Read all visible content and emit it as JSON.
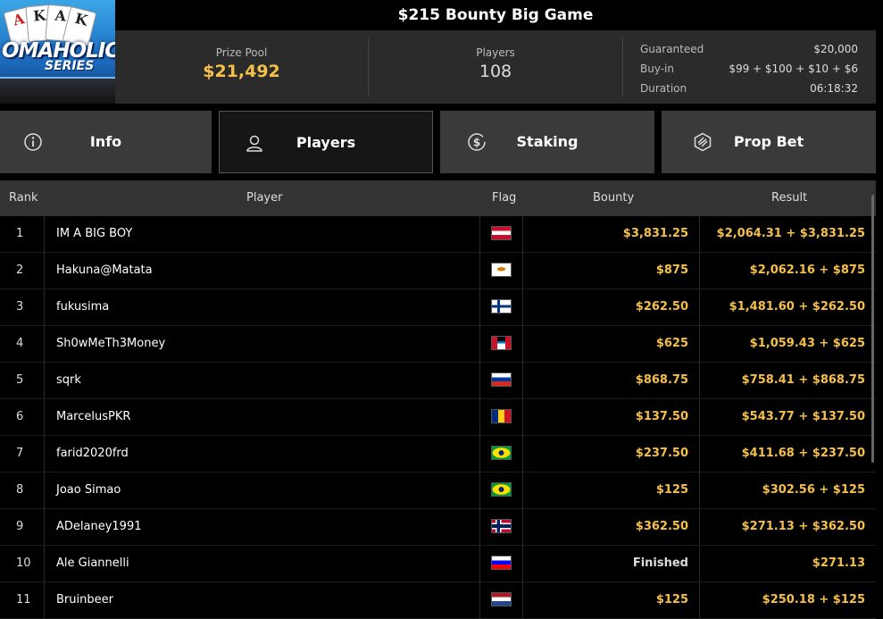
{
  "header": {
    "title": "$215 Bounty Big Game",
    "logo": {
      "title": "OMAHOLIC",
      "series": "SERIES",
      "cards": [
        "A",
        "K",
        "A",
        "K"
      ]
    },
    "prize_pool": {
      "label": "Prize Pool",
      "value": "$21,492"
    },
    "players": {
      "label": "Players",
      "value": "108"
    },
    "details": [
      {
        "label": "Guaranteed",
        "value": "$20,000"
      },
      {
        "label": "Buy-in",
        "value": "$99 + $100 + $10 + $6"
      },
      {
        "label": "Duration",
        "value": "06:18:32"
      }
    ]
  },
  "tabs": [
    {
      "label": "Info",
      "icon": "info-icon",
      "active": false
    },
    {
      "label": "Players",
      "icon": "user-icon",
      "active": true
    },
    {
      "label": "Staking",
      "icon": "dollar-coin-icon",
      "active": false
    },
    {
      "label": "Prop Bet",
      "icon": "prop-bet-icon",
      "active": false
    }
  ],
  "table": {
    "columns": [
      "Rank",
      "Player",
      "Flag",
      "Bounty",
      "Result"
    ],
    "rows": [
      {
        "rank": "1",
        "player": "IM A BIG BOY",
        "flag": "austria",
        "bounty": "$3,831.25",
        "result": "$2,064.31 + $3,831.25"
      },
      {
        "rank": "2",
        "player": "Hakuna@Matata",
        "flag": "cyprus",
        "bounty": "$875",
        "result": "$2,062.16 + $875"
      },
      {
        "rank": "3",
        "player": "fukusima",
        "flag": "finland",
        "bounty": "$262.50",
        "result": "$1,481.60 + $262.50"
      },
      {
        "rank": "4",
        "player": "Sh0wMeTh3Money",
        "flag": "antigua",
        "bounty": "$625",
        "result": "$1,059.43 + $625"
      },
      {
        "rank": "5",
        "player": "sqrk",
        "flag": "russia",
        "bounty": "$868.75",
        "result": "$758.41 + $868.75"
      },
      {
        "rank": "6",
        "player": "MarcelusPKR",
        "flag": "romania",
        "bounty": "$137.50",
        "result": "$543.77 + $137.50"
      },
      {
        "rank": "7",
        "player": "farid2020frd",
        "flag": "brazil",
        "bounty": "$237.50",
        "result": "$411.68 + $237.50"
      },
      {
        "rank": "8",
        "player": "Joao Simao",
        "flag": "brazil",
        "bounty": "$125",
        "result": "$302.56 + $125"
      },
      {
        "rank": "9",
        "player": "ADelaney1991",
        "flag": "norway",
        "bounty": "$362.50",
        "result": "$271.13 + $362.50"
      },
      {
        "rank": "10",
        "player": "Ale Giannelli",
        "flag": "slovenia",
        "bounty": "Finished",
        "result": "$271.13"
      },
      {
        "rank": "11",
        "player": "Bruinbeer",
        "flag": "netherlands",
        "bounty": "$125",
        "result": "$250.18 + $125"
      }
    ]
  },
  "colors": {
    "accent": "#f5c04a",
    "panel": "#2b2b2b",
    "tab": "#3a3a3a",
    "background": "#000000"
  }
}
